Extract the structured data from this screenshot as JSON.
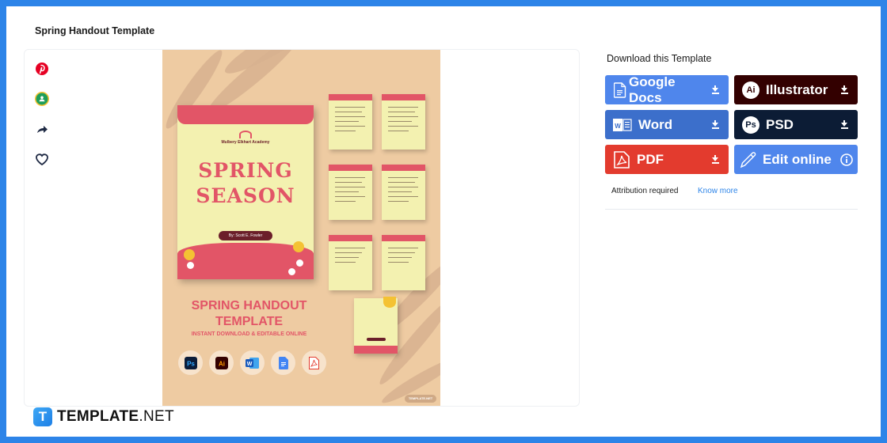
{
  "page": {
    "title": "Spring Handout Template"
  },
  "social": [
    {
      "name": "pinterest",
      "icon": "pinterest-icon"
    },
    {
      "name": "google-classroom",
      "icon": "google-classroom-icon"
    },
    {
      "name": "share",
      "icon": "share-icon"
    },
    {
      "name": "favorite",
      "icon": "heart-icon"
    }
  ],
  "preview": {
    "cover": {
      "academy": "Mulbery Elkhart Academy",
      "title_line1": "SPRING",
      "title_line2": "SEASON",
      "author": "By: Scott E. Fowler"
    },
    "promo": {
      "title_line1": "SPRING HANDOUT",
      "title_line2": "TEMPLATE",
      "subtitle": "INSTANT DOWNLOAD & EDITABLE ONLINE",
      "apps": [
        "Ps",
        "Ai",
        "W",
        "Docs",
        "PDF"
      ]
    },
    "watermark": "TEMPLATE.NET"
  },
  "download": {
    "title": "Download this Template",
    "buttons": [
      {
        "label": "Google Docs",
        "color": "#4f86ec",
        "icon": "google-docs-icon"
      },
      {
        "label": "Illustrator",
        "color": "#330000",
        "icon": "illustrator-icon",
        "badge": "Ai"
      },
      {
        "label": "Word",
        "color": "#3c6fcb",
        "icon": "word-icon"
      },
      {
        "label": "PSD",
        "color": "#0c1c35",
        "icon": "photoshop-icon",
        "badge": "Ps"
      },
      {
        "label": "PDF",
        "color": "#e33b2e",
        "icon": "pdf-icon"
      },
      {
        "label": "Edit online",
        "color": "#4f86ec",
        "icon": "pencil-icon"
      }
    ],
    "attribution": "Attribution required",
    "know_more": "Know more"
  },
  "brand": {
    "letter": "T",
    "name_bold": "TEMPLATE",
    "name_light": ".NET"
  }
}
